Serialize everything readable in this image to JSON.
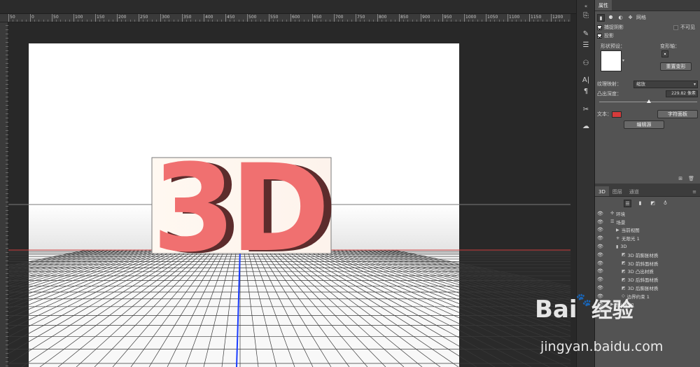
{
  "ruler": {
    "labels": [
      "50",
      "0",
      "50",
      "100",
      "150",
      "200",
      "250",
      "300",
      "350",
      "400",
      "450",
      "500",
      "550",
      "600",
      "650",
      "700",
      "750",
      "800",
      "850",
      "900",
      "950",
      "1000",
      "1050",
      "1100",
      "1150",
      "1200",
      "1250"
    ]
  },
  "scene_text": {
    "label": "3D"
  },
  "properties": {
    "tab_label": "属性",
    "mode_icons": [
      "mesh-icon",
      "deform-icon",
      "cap-icon",
      "coordinates-icon"
    ],
    "mode_label": "网格",
    "catch_shadow_label": "捕捉阴影",
    "invisible_label": "不可见",
    "cast_shadow_label": "投影",
    "shape_preset_label": "形状预设：",
    "deform_axis_label": "变形轴：",
    "reset_deform_label": "重置变形",
    "texture_mapping_label": "纹理映射：",
    "texture_mapping_value": "缩放",
    "extrusion_depth_label": "凸出深度：",
    "extrusion_depth_value": "229.82 像素",
    "extrusion_depth_fraction": 0.52,
    "text_label": "文本：",
    "text_color": "#d63b3b",
    "char_panel_label": "字符面板",
    "edit_source_label": "编辑源"
  },
  "layers_panel": {
    "tabs": [
      "3D",
      "图层",
      "通道"
    ],
    "filter_icons": [
      "scene-icon",
      "mesh-filter-icon",
      "material-icon",
      "light-icon"
    ],
    "items": [
      {
        "label": "环境",
        "icon": "environment-icon",
        "indent": 0
      },
      {
        "label": "场景",
        "icon": "scene-icon",
        "indent": 0
      },
      {
        "label": "当前视图",
        "icon": "camera-icon",
        "indent": 1
      },
      {
        "label": "无限光 1",
        "icon": "light-icon",
        "indent": 1
      },
      {
        "label": "3D",
        "icon": "mesh-icon",
        "indent": 1
      },
      {
        "label": "3D 前膨胀材质",
        "icon": "material-icon",
        "indent": 2
      },
      {
        "label": "3D 前斜面材质",
        "icon": "material-icon",
        "indent": 2
      },
      {
        "label": "3D 凸出材质",
        "icon": "material-icon",
        "indent": 2
      },
      {
        "label": "3D 后斜面材质",
        "icon": "material-icon",
        "indent": 2
      },
      {
        "label": "3D 后膨胀材质",
        "icon": "material-icon",
        "indent": 2
      },
      {
        "label": "边界约束 1",
        "icon": "constraint-icon",
        "indent": 2
      },
      {
        "label": "默认相机",
        "icon": "camera-icon",
        "indent": 0
      }
    ]
  },
  "watermark": {
    "brand_a": "Bai",
    "brand_b": "经验",
    "url": "jingyan.baidu.com"
  }
}
